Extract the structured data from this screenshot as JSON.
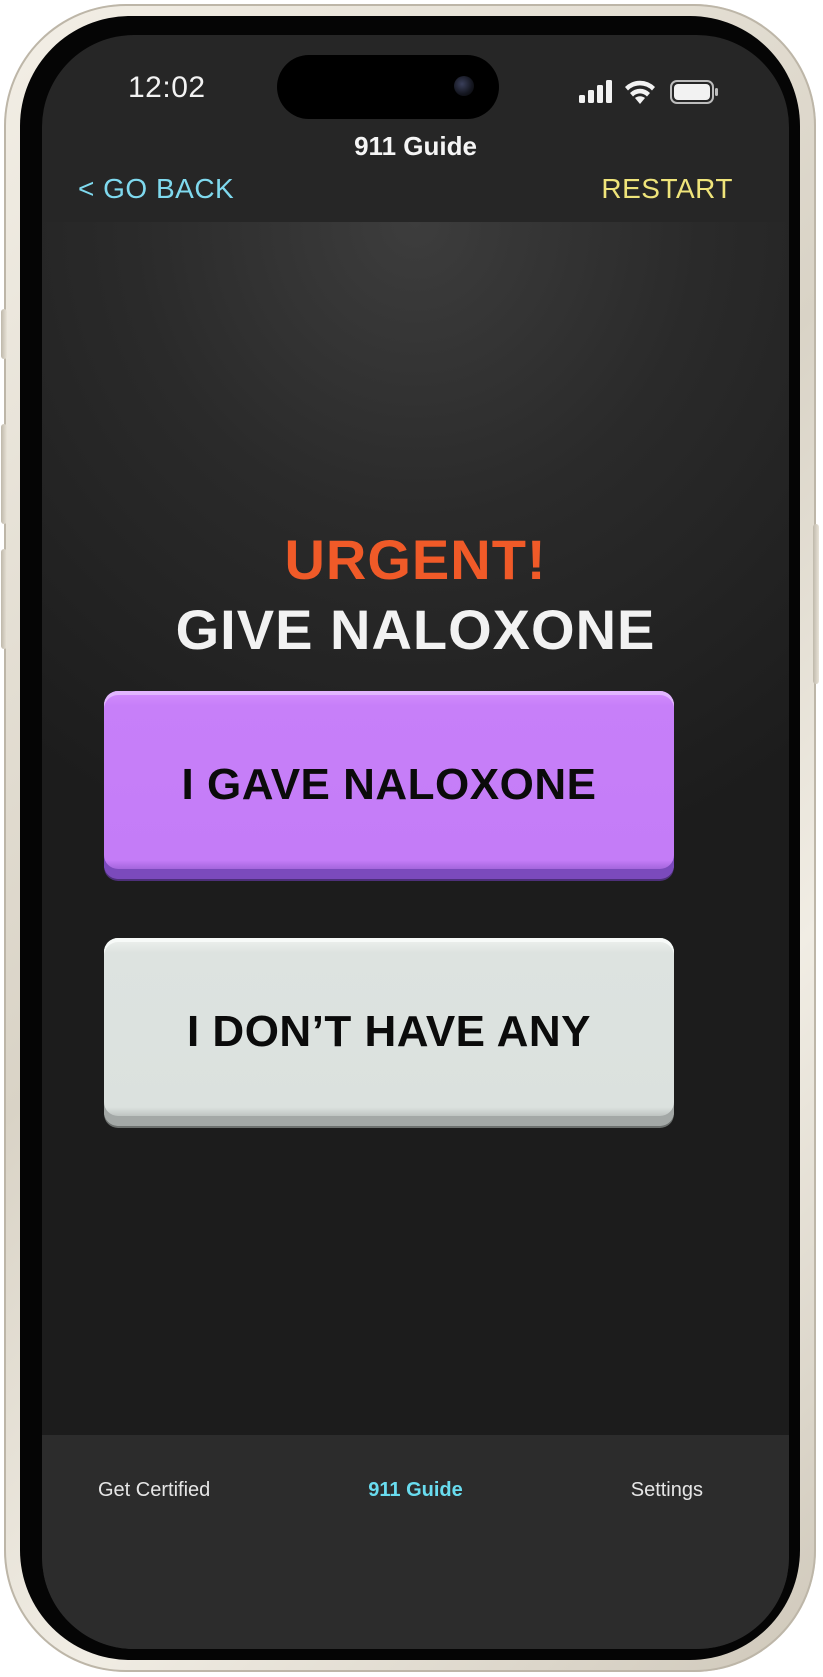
{
  "status_bar": {
    "time": "12:02"
  },
  "header": {
    "title": "911 Guide",
    "go_back_label": "< GO BACK",
    "restart_label": "RESTART"
  },
  "main": {
    "urgent_label": "URGENT!",
    "instruction": "GIVE NALOXONE",
    "primary_button": "I GAVE NALOXONE",
    "secondary_button": "I DON’T HAVE ANY"
  },
  "tab_bar": {
    "items": [
      {
        "label": "Get Certified"
      },
      {
        "label": "911 Guide",
        "active": true
      },
      {
        "label": "Settings"
      }
    ]
  },
  "colors": {
    "accent_cyan": "#69dcef",
    "restart_yellow": "#efe47a",
    "urgent_orange": "#f05a28",
    "primary_purple": "#c77ff9",
    "secondary_gray": "#dbe1de",
    "background": "#262626"
  }
}
